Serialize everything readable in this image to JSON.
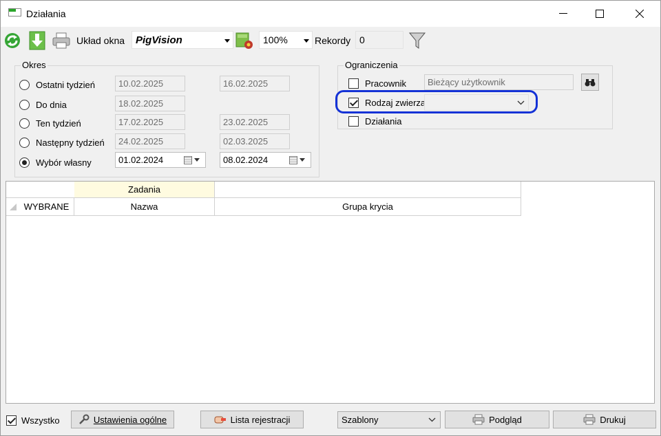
{
  "window": {
    "title": "Działania"
  },
  "toolbar": {
    "layout_label": "Układ okna",
    "layout_value": "PigVision",
    "zoom_value": "100%",
    "records_label": "Rekordy",
    "records_value": "0",
    "icons": [
      "refresh-icon",
      "download-icon",
      "print-icon",
      "layout-settings-icon",
      "filter-icon"
    ]
  },
  "period": {
    "title": "Okres",
    "options": [
      {
        "label": "Ostatni tydzień",
        "from": "10.02.2025",
        "to": "16.02.2025",
        "checked": false
      },
      {
        "label": "Do dnia",
        "from": "18.02.2025",
        "to": "",
        "checked": false
      },
      {
        "label": "Ten tydzień",
        "from": "17.02.2025",
        "to": "23.02.2025",
        "checked": false
      },
      {
        "label": "Następny tydzień",
        "from": "24.02.2025",
        "to": "02.03.2025",
        "checked": false
      },
      {
        "label": "Wybór własny",
        "from": "01.02.2024",
        "to": "08.02.2024",
        "checked": true
      }
    ]
  },
  "constraints": {
    "title": "Ograniczenia",
    "employee_label": "Pracownik",
    "employee_value": "Bieżący użytkownik",
    "employee_checked": false,
    "animal_type_label": "Rodzaj zwierza",
    "animal_type_value": "",
    "animal_type_checked": true,
    "actions_label": "Działania",
    "actions_checked": false
  },
  "grid": {
    "band_header": "Zadania",
    "columns": [
      "WYBRANE",
      "Nazwa",
      "Grupa krycia"
    ]
  },
  "footer": {
    "all_label": "Wszystko",
    "all_checked": true,
    "general_settings_label": "Ustawienia ogólne",
    "registration_list_label": "Lista rejestracji",
    "templates_value": "Szablony",
    "preview_label": "Podgląd",
    "print_label": "Drukuj"
  },
  "colors": {
    "highlight": "#1432d6",
    "band_header_bg": "#fffbe0"
  }
}
